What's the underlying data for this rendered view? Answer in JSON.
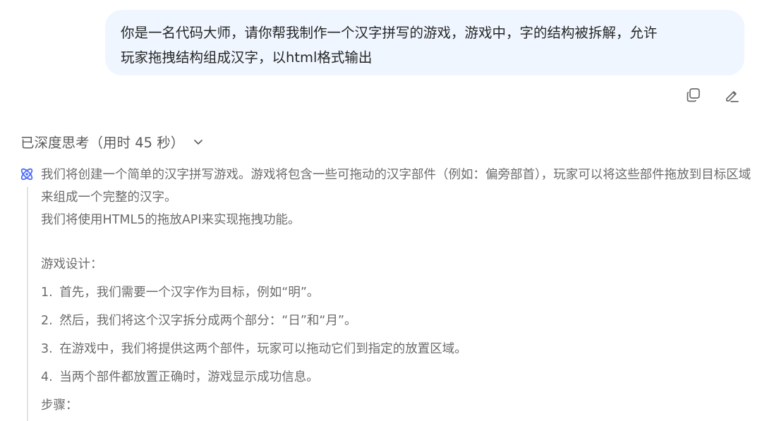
{
  "user_message": {
    "line1": "你是一名代码大师，请你帮我制作一个汉字拼写的游戏，游戏中，字的结构被拆解，允许",
    "line2": "玩家拖拽结构组成汉字，以html格式输出"
  },
  "message_actions": {
    "copy_icon": "copy-icon",
    "edit_icon": "edit-icon"
  },
  "thinking": {
    "label": "已深度思考（用时 45 秒）",
    "paragraph1": "我们将创建一个简单的汉字拼写游戏。游戏将包含一些可拖动的汉字部件（例如：偏旁部首），玩家可以将这些部件拖放到目标区域来组成一个完整的汉字。",
    "paragraph2": "我们将使用HTML5的拖放API来实现拖拽功能。",
    "design_title": "游戏设计：",
    "design_steps": [
      {
        "num": "1.",
        "text": "首先，我们需要一个汉字作为目标，例如“明”。"
      },
      {
        "num": "2.",
        "text": "然后，我们将这个汉字拆分成两个部分：“日”和“月”。"
      },
      {
        "num": "3.",
        "text": "在游戏中，我们将提供这两个部件，玩家可以拖动它们到指定的放置区域。"
      },
      {
        "num": "4.",
        "text": "当两个部件都放置正确时，游戏显示成功信息。"
      }
    ],
    "steps_title": "步骤："
  },
  "colors": {
    "bubble_bg": "#eff6ff",
    "accent": "#4d6bfe",
    "muted_text": "#6b6b6b"
  }
}
